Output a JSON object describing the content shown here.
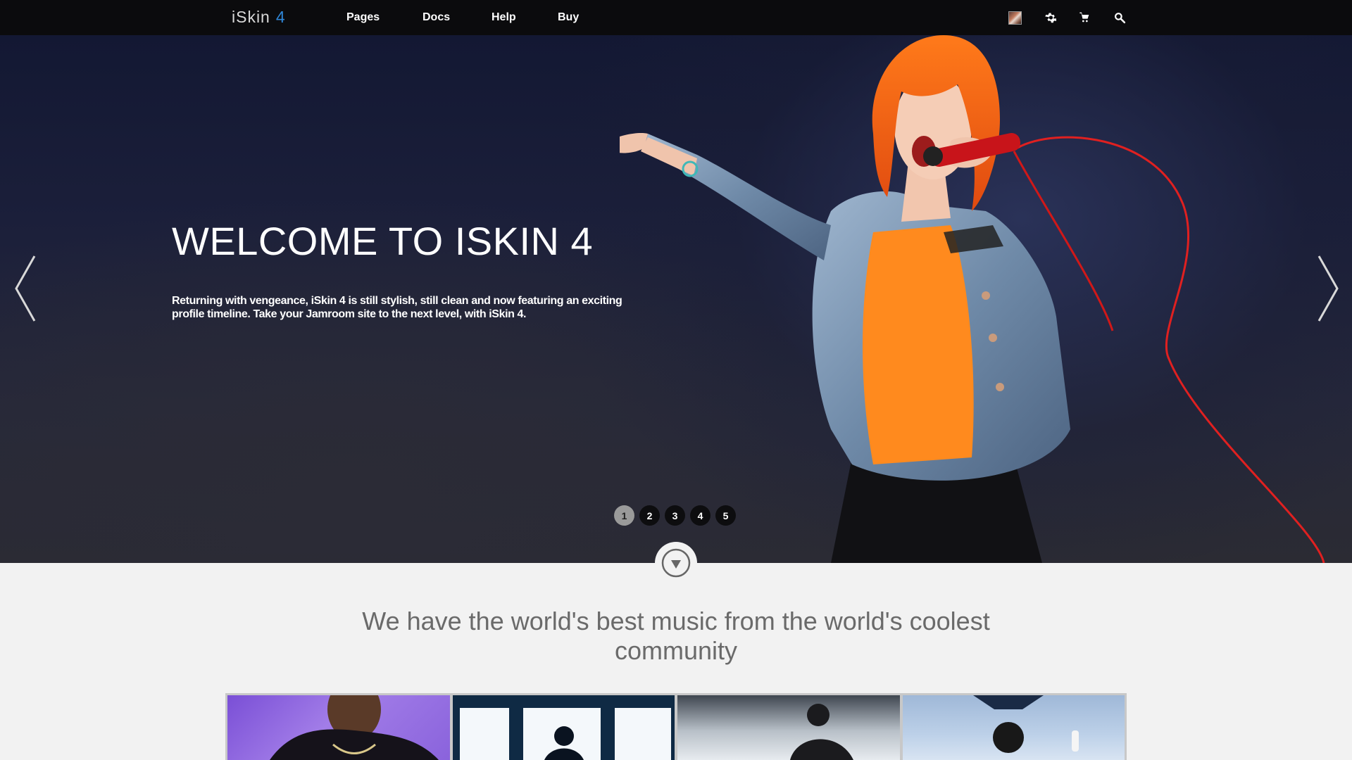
{
  "app": {
    "logo_text": "iSkin",
    "logo_number": "4"
  },
  "nav": {
    "items": [
      "Pages",
      "Docs",
      "Help",
      "Buy"
    ]
  },
  "toolbar": {
    "icons": [
      "avatar",
      "gear-icon",
      "cart-icon",
      "search-icon"
    ]
  },
  "hero": {
    "title": "WELCOME TO ISKIN 4",
    "text": "Returning with vengeance, iSkin 4 is still stylish, still clean and now featuring an exciting profile timeline. Take your Jamroom site to the next level, with iSkin 4.",
    "slides": [
      "1",
      "2",
      "3",
      "4",
      "5"
    ],
    "active_slide": 1
  },
  "section": {
    "tagline": "We have the world's best music from the world's coolest community"
  },
  "colors": {
    "topbar": "#0b0b0d",
    "logo_accent": "#2f86d6",
    "background": "#f2f2f2",
    "tagline": "#6a6a6a"
  }
}
